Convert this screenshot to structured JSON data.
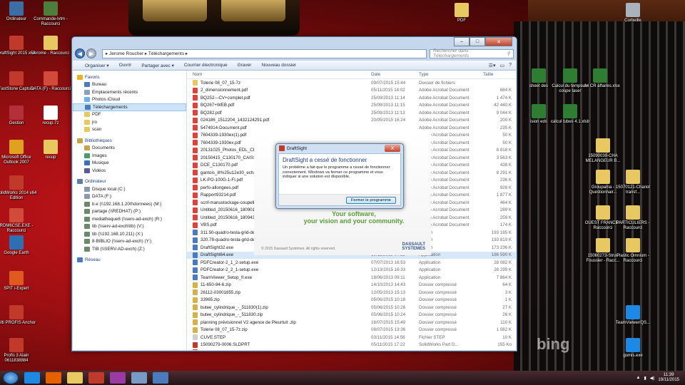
{
  "desktop": {
    "left_icons": [
      {
        "label": "Ordinateur",
        "icon": "computer-icon",
        "color": "#3b6ea5"
      },
      {
        "label": "Commande-lvtm - Raccourci",
        "icon": "doc-icon",
        "color": "#4d7e3b"
      },
      {
        "label": "DraftSight 2015 x64",
        "icon": "draftsight-icon",
        "color": "#c0392b"
      },
      {
        "label": "Jerome - Raccourci",
        "icon": "folder-icon",
        "color": "#e8c860"
      },
      {
        "label": "FastStone Capture",
        "icon": "capture-icon",
        "color": "#c0392b"
      },
      {
        "label": "DATA (F) - Raccourci",
        "icon": "drive-icon",
        "color": "#d24b3a"
      },
      {
        "label": "Gestion",
        "icon": "gestion-icon",
        "color": "#b1303a"
      },
      {
        "label": "recup.7z",
        "icon": "archive-icon",
        "color": "#ffffff"
      },
      {
        "label": "Microsoft Office Outlook 2007",
        "icon": "outlook-icon",
        "color": "#e0a020"
      },
      {
        "label": "recup",
        "icon": "folder-icon",
        "color": "#e8c860"
      },
      {
        "label": "SolidWorks 2014 x64 Edition",
        "icon": "solidworks-icon",
        "color": "#c0392b"
      },
      {
        "label": "RDM6CSE.EXE - Raccourci",
        "icon": "exe-icon",
        "color": "#d24b3a"
      },
      {
        "label": "Google Earth",
        "icon": "globe-icon",
        "color": "#2d6fb2"
      },
      {
        "label": "SPIT i-Expert",
        "icon": "spit-icon",
        "color": "#e05a20"
      },
      {
        "label": "Hilti PROFIS Anchor",
        "icon": "hilti-icon",
        "color": "#c0392b"
      },
      {
        "label": "Profis 3 Alain 0611838884",
        "icon": "profis-icon",
        "color": "#c0392b"
      }
    ],
    "right_icons": [
      {
        "label": "PDF",
        "icon": "folder-icon",
        "color": "#e8c860"
      },
      {
        "label": "Corbeille",
        "icon": "trash-icon",
        "color": "#a9b3bd"
      },
      {
        "label": "sheet des",
        "icon": "excel-icon",
        "color": "#2e7d32"
      },
      {
        "label": "Calcul du temps de coupe laser",
        "icon": "excel-icon",
        "color": "#2e7d32"
      },
      {
        "label": "suivi CR affaires.xlsx",
        "icon": "excel-icon",
        "color": "#2e7d32"
      },
      {
        "label": "ision eds",
        "icon": "excel-icon",
        "color": "#2e7d32"
      },
      {
        "label": "calcul tubes 4.1.xlsb",
        "icon": "excel-icon",
        "color": "#2e7d32"
      },
      {
        "label": "15090039-CHA MELANGEUR B...",
        "icon": "file-icon",
        "color": "#e8c860"
      },
      {
        "label": "Groupama - Questionnair...",
        "icon": "folder-icon",
        "color": "#e8c860"
      },
      {
        "label": "15070121-Chariot transf...",
        "icon": "folder-icon",
        "color": "#e8c860"
      },
      {
        "label": "OUEST FRANCE - Raccourci",
        "icon": "folder-icon",
        "color": "#e8c860"
      },
      {
        "label": "PARTICULIERS - Raccourci",
        "icon": "folder-icon",
        "color": "#e8c860"
      },
      {
        "label": "15060273-Struc Foussier - Racc...",
        "icon": "folder-icon",
        "color": "#e8c860"
      },
      {
        "label": "Plastic Omnium - Raccourci",
        "icon": "folder-icon",
        "color": "#e8c860"
      },
      {
        "label": "TeamViewer/QS...",
        "icon": "teamviewer-icon",
        "color": "#1e88e5"
      },
      {
        "label": "gomis.exe",
        "icon": "exe-icon",
        "color": "#1e88e5"
      }
    ],
    "watermark": "bing"
  },
  "explorer": {
    "breadcrumb": "▸ Jerome Roucher ▸ Téléchargements ▸",
    "search_placeholder": "Rechercher dans : Téléchargements",
    "toolbar": [
      "Organiser ▾",
      "Ouvrir",
      "Partager avec ▾",
      "Courrier électronique",
      "Graver",
      "Nouveau dossier"
    ],
    "nav": [
      {
        "label": "Favoris",
        "icon": "star-icon",
        "color": "#e6b422",
        "level": 0
      },
      {
        "label": "Bureau",
        "icon": "desktop-icon",
        "color": "#4a7bbd",
        "level": 1
      },
      {
        "label": "Emplacements récents",
        "icon": "recent-icon",
        "color": "#8a9fb8",
        "level": 1
      },
      {
        "label": "Photos iCloud",
        "icon": "cloud-icon",
        "color": "#6fb0e8",
        "level": 1
      },
      {
        "label": "Téléchargements",
        "icon": "download-icon",
        "color": "#4a7bbd",
        "level": 1,
        "selected": true
      },
      {
        "label": "PDF",
        "icon": "folder-icon",
        "color": "#e8c860",
        "level": 1
      },
      {
        "label": "jro",
        "icon": "folder-icon",
        "color": "#e8c860",
        "level": 1
      },
      {
        "label": "scan",
        "icon": "folder-icon",
        "color": "#e8c860",
        "level": 1
      },
      {
        "gap": true
      },
      {
        "label": "Bibliothèques",
        "icon": "library-icon",
        "color": "#c4a24e",
        "level": 0
      },
      {
        "label": "Documents",
        "icon": "documents-icon",
        "color": "#c4a24e",
        "level": 1
      },
      {
        "label": "Images",
        "icon": "images-icon",
        "color": "#4a9b6a",
        "level": 1
      },
      {
        "label": "Musique",
        "icon": "music-icon",
        "color": "#3c6fb5",
        "level": 1
      },
      {
        "label": "Vidéos",
        "icon": "videos-icon",
        "color": "#5a5a9a",
        "level": 1
      },
      {
        "gap": true
      },
      {
        "label": "Ordinateur",
        "icon": "computer-icon",
        "color": "#5b7fa8",
        "level": 0
      },
      {
        "label": "Disque local (C:)",
        "icon": "drive-icon",
        "color": "#8a9aaa",
        "level": 1
      },
      {
        "label": "DATA (F:)",
        "icon": "drive-icon",
        "color": "#8a9aaa",
        "level": 1
      },
      {
        "label": "b.e (\\\\192.168.1.200\\donnees) (M:)",
        "icon": "netdrive-icon",
        "color": "#6a8a6a",
        "level": 1
      },
      {
        "label": "partage (\\\\REDHAT) (P:)",
        "icon": "netdrive-icon",
        "color": "#6a8a6a",
        "level": 1
      },
      {
        "label": "mediatheque6 (\\\\serv-ad-exch) (R:)",
        "icon": "netdrive-icon",
        "color": "#6a8a6a",
        "level": 1
      },
      {
        "label": "tib (\\\\serv-ad-exch\\tib) (V:)",
        "icon": "netdrive-icon",
        "color": "#6a8a6a",
        "level": 1
      },
      {
        "label": "tib (\\\\192.168.10.211) (X:)",
        "icon": "netdrive-icon",
        "color": "#6a8a6a",
        "level": 1
      },
      {
        "label": "8-BIBLIO (\\\\serv-ad-exch) (Y:)",
        "icon": "netdrive-icon",
        "color": "#6a8a6a",
        "level": 1
      },
      {
        "label": "TIB (\\\\SERV-AD-exch) (Z:)",
        "icon": "netdrive-icon",
        "color": "#6a8a6a",
        "level": 1
      },
      {
        "gap": true
      },
      {
        "label": "Réseau",
        "icon": "network-icon",
        "color": "#4a7bbd",
        "level": 0
      }
    ],
    "columns": [
      "Nom",
      "Date",
      "Type",
      "Taille"
    ],
    "files": [
      {
        "name": "Tolerie 08_07_15-7z",
        "date": "09/07/2015 15:44",
        "type": "Dossier de fichiers",
        "size": "",
        "kind": "folder"
      },
      {
        "name": "2_dimensionnement.pdf",
        "date": "05/11/2015 14:02",
        "type": "Adobe Acrobat Document",
        "size": "684 K",
        "kind": "pdf"
      },
      {
        "name": "BQ252---CV+complet.pdf",
        "date": "25/09/2013 11:14",
        "type": "Adobe Acrobat Document",
        "size": "1 474 K",
        "kind": "pdf"
      },
      {
        "name": "BQ267+WEB.pdf",
        "date": "25/09/2013 11:15",
        "type": "Adobe Acrobat Document",
        "size": "42 440 K",
        "kind": "pdf"
      },
      {
        "name": "BQ282.pdf",
        "date": "25/09/2013 11:13",
        "type": "Adobe Acrobat Document",
        "size": "9 044 K",
        "kind": "pdf"
      },
      {
        "name": "024186_1512204_1432124291.pdf",
        "date": "20/05/2015 16:24",
        "type": "Adobe Acrobat Document",
        "size": "200 K",
        "kind": "pdf"
      },
      {
        "name": "5474914-Document.pdf",
        "date": "",
        "type": "Adobe Acrobat Document",
        "size": "235 K",
        "kind": "pdf"
      },
      {
        "name": "7604339-1930ex(1).pdf",
        "date": "",
        "type": "Adobe Acrobat Document",
        "size": "50 K",
        "kind": "pdf"
      },
      {
        "name": "7604339-1930ex.pdf",
        "date": "",
        "type": "Adobe Acrobat Document",
        "size": "50 K",
        "kind": "pdf"
      },
      {
        "name": "20131025_Photos_EDL_CEBP",
        "date": "",
        "type": "Adobe Acrobat Document",
        "size": "8 818 K",
        "kind": "pdf"
      },
      {
        "name": "20150415_C130170_CAISSE E",
        "date": "",
        "type": "Adobe Acrobat Document",
        "size": "3 563 K",
        "kind": "pdf"
      },
      {
        "name": "DCE_C130170.pdf",
        "date": "",
        "type": "Adobe Acrobat Document",
        "size": "438 K",
        "kind": "pdf"
      },
      {
        "name": "gantois_lit%25u12e30_echant",
        "date": "",
        "type": "Adobe Acrobat Document",
        "size": "8 291 K",
        "kind": "pdf"
      },
      {
        "name": "LK-PO-100G-1-FI.pdf",
        "date": "",
        "type": "Adobe Acrobat Document",
        "size": "236 K",
        "kind": "pdf"
      },
      {
        "name": "perfo-allongees.pdf",
        "date": "",
        "type": "Adobe Acrobat Document",
        "size": "928 K",
        "kind": "pdf"
      },
      {
        "name": "Rapport93214.pdf",
        "date": "",
        "type": "Adobe Acrobat Document",
        "size": "1 877 K",
        "kind": "pdf"
      },
      {
        "name": "scnf-manustockage-coupell",
        "date": "",
        "type": "Adobe Acrobat Document",
        "size": "464 K",
        "kind": "pdf"
      },
      {
        "name": "Untitled_20150616_180901_00",
        "date": "",
        "type": "Adobe Acrobat Document",
        "size": "289 K",
        "kind": "pdf"
      },
      {
        "name": "Untitled_20150616_180943_00",
        "date": "",
        "type": "Adobe Acrobat Document",
        "size": "259 K",
        "kind": "pdf"
      },
      {
        "name": "VBS.pdf",
        "date": "",
        "type": "Adobe Acrobat Document",
        "size": "174 K",
        "kind": "pdf"
      },
      {
        "name": "311.50-quadro-tesla-grid-de",
        "date": "",
        "type": "lication",
        "size": "193 185 K",
        "kind": "exe"
      },
      {
        "name": "320.78-quadro-tesla-grid-de",
        "date": "",
        "type": "lication",
        "size": "193 819 K",
        "kind": "exe"
      },
      {
        "name": "DraftSight32.exe",
        "date": "",
        "type": "lication",
        "size": "173 236 K",
        "kind": "exe"
      },
      {
        "name": "DraftSight64.exe",
        "date": "19/11/2015 07:52",
        "type": "Application",
        "size": "186 590 K",
        "kind": "exe",
        "selected": true
      },
      {
        "name": "PDFCreator-2_1_2-setup.exe",
        "date": "07/07/2013 16:53",
        "type": "Application",
        "size": "28 082 K",
        "kind": "exe"
      },
      {
        "name": "PDFCreator-2_2_1-setup.exe",
        "date": "12/13/2015 16:33",
        "type": "Application",
        "size": "26 299 K",
        "kind": "exe"
      },
      {
        "name": "TeamViewer_Setup_fr.exe",
        "date": "18/06/2013 09:11",
        "type": "Application",
        "size": "7 864 K",
        "kind": "exe"
      },
      {
        "name": "11-650-94-6.zip",
        "date": "14/10/2013 14:43",
        "type": "Dossier compressé",
        "size": "64 K",
        "kind": "zip"
      },
      {
        "name": "26112-03001855.zip",
        "date": "12/05/2013 15:13",
        "type": "Dossier compressé",
        "size": "3 K",
        "kind": "zip"
      },
      {
        "name": "33965.zip",
        "date": "05/06/2015 10:18",
        "type": "Dossier compressé",
        "size": "1 K",
        "kind": "zip"
      },
      {
        "name": "butee_cylindrique_-_511830(1).zip",
        "date": "05/06/2015 10:26",
        "type": "Dossier compressé",
        "size": "27 K",
        "kind": "zip"
      },
      {
        "name": "butee_cylindrique_-_511830.zip",
        "date": "05/06/2015 10:24",
        "type": "Dossier compressé",
        "size": "26 K",
        "kind": "zip"
      },
      {
        "name": "planning prévisionnel V2 agence de Pleurtuit .zip",
        "date": "16/07/2015 15:49",
        "type": "Dossier compressé",
        "size": "110 K",
        "kind": "zip"
      },
      {
        "name": "Tolerie 08_07_15-7z.zip",
        "date": "08/07/2015 13:36",
        "type": "Dossier compressé",
        "size": "1 082 K",
        "kind": "zip"
      },
      {
        "name": "CUVE.STEP",
        "date": "03/11/2015 14:56",
        "type": "Fichier STEP",
        "size": "10 K",
        "kind": "file"
      },
      {
        "name": "15090279-0006.SLDPRT",
        "date": "05/11/2015 17:22",
        "type": "SolidWorks Part D...",
        "size": "155 Ko",
        "kind": "sw"
      },
      {
        "name": "15090279-0030.SLDPRT",
        "date": "05/11/2015 14:31",
        "type": "SolidWorks Part D...",
        "size": "127 Ko",
        "kind": "sw"
      }
    ]
  },
  "dialog": {
    "title": "DraftSight",
    "heading": "DraftSight a cessé de fonctionner",
    "message": "Un problème a fait que le programme a cessé de fonctionner correctement. Windows va fermer ce programme et vous indiquer si une solution est disponible.",
    "button": "Fermer le programme",
    "close": "X",
    "splash_slogan_1": "Your software,",
    "splash_slogan_2": "your vision and your community.",
    "splash_copyright": "© 2015 Dassault Systèmes. All rights reserved.",
    "splash_logo_1": "DASSAULT",
    "splash_logo_2": "SYSTEMES"
  },
  "taskbar": {
    "items": [
      {
        "icon": "ie-icon",
        "color": "#1e88e5"
      },
      {
        "icon": "firefox-icon",
        "color": "#e66000"
      },
      {
        "icon": "explorer-icon",
        "color": "#e8c860"
      },
      {
        "icon": "solidworks-icon",
        "color": "#c0392b"
      },
      {
        "icon": "app-icon",
        "color": "#9b3aa3"
      },
      {
        "icon": "notepad-icon",
        "color": "#7a9ac6"
      },
      {
        "icon": "draftsight-icon",
        "color": "#4a7bbd"
      }
    ],
    "time": "11:39",
    "date": "19/11/2015"
  }
}
